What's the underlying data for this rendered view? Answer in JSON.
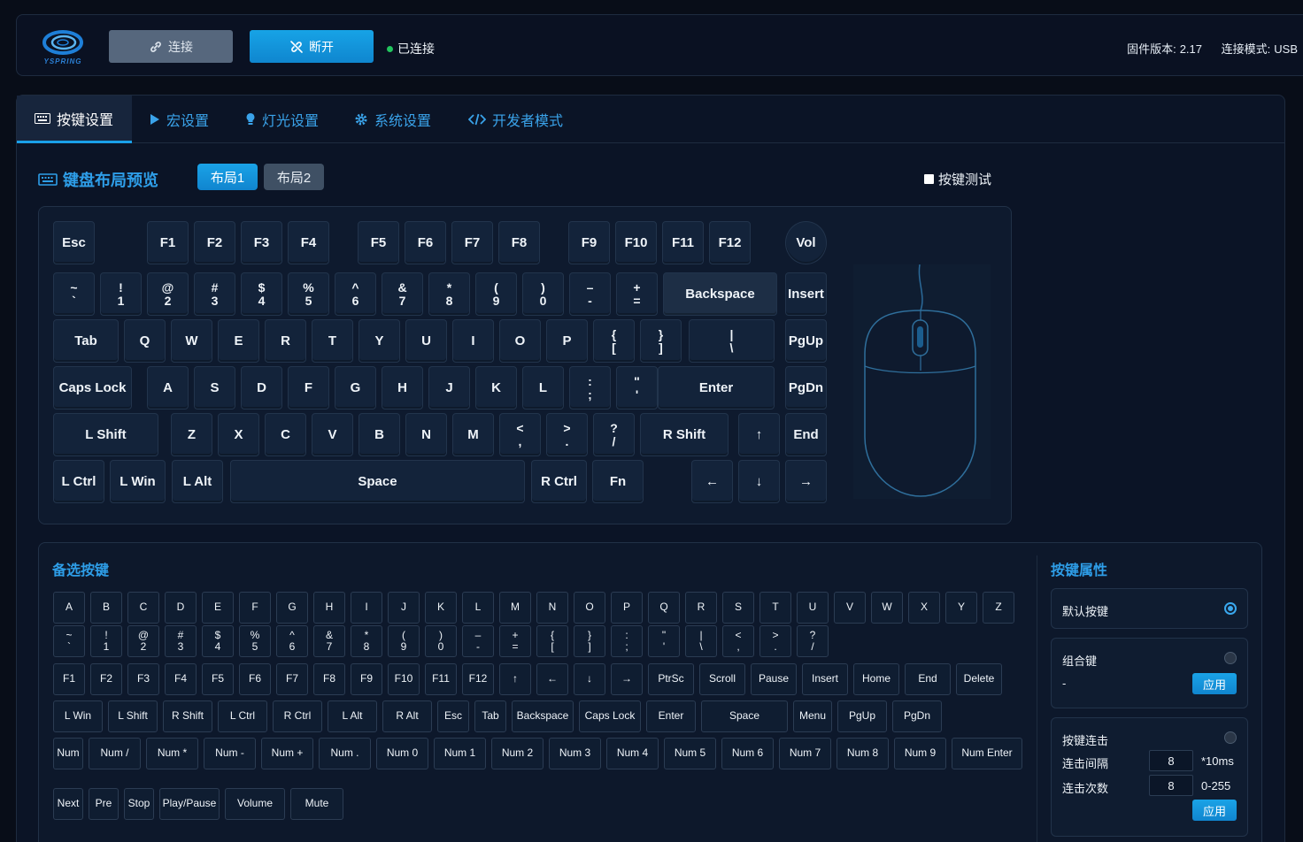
{
  "header": {
    "logo_text": "YSPRING",
    "connect_label": "连接",
    "disconnect_label": "断开",
    "status_text": "已连接",
    "firmware_label": "固件版本:",
    "firmware_value": "2.17",
    "mode_label": "连接模式:",
    "mode_value": "USB"
  },
  "tabs": [
    "按键设置",
    "宏设置",
    "灯光设置",
    "系统设置",
    "开发者模式"
  ],
  "layout_section": {
    "title": "键盘布局预览",
    "layout1": "布局1",
    "layout2": "布局2",
    "key_test": "按键测试"
  },
  "keyboard": {
    "rows": [
      [
        "Esc",
        "F1",
        "F2",
        "F3",
        "F4",
        "F5",
        "F6",
        "F7",
        "F8",
        "F9",
        "F10",
        "F11",
        "F12",
        "Vol"
      ],
      [
        "~\n`",
        "!\n1",
        "@\n2",
        "#\n3",
        "$\n4",
        "%\n5",
        "^\n6",
        "&\n7",
        "*\n8",
        "(\n9",
        ")\n0",
        "–\n-",
        "+\n=",
        "Backspace",
        "Insert"
      ],
      [
        "Tab",
        "Q",
        "W",
        "E",
        "R",
        "T",
        "Y",
        "U",
        "I",
        "O",
        "P",
        "{\n[",
        "}\n]",
        "|\n\\",
        "PgUp"
      ],
      [
        "Caps Lock",
        "A",
        "S",
        "D",
        "F",
        "G",
        "H",
        "J",
        "K",
        "L",
        ":\n;",
        "\"\n'",
        "Enter",
        "PgDn"
      ],
      [
        "L Shift",
        "Z",
        "X",
        "C",
        "V",
        "B",
        "N",
        "M",
        "<\n,",
        ">\n.",
        "?\n/",
        "R Shift",
        "↑",
        "End"
      ],
      [
        "L Ctrl",
        "L Win",
        "L Alt",
        "Space",
        "R Ctrl",
        "Fn",
        "←",
        "↓",
        "→"
      ]
    ]
  },
  "alt_section": {
    "title": "备选按键",
    "rows": [
      [
        "A",
        "B",
        "C",
        "D",
        "E",
        "F",
        "G",
        "H",
        "I",
        "J",
        "K",
        "L",
        "M",
        "N",
        "O",
        "P",
        "Q",
        "R",
        "S",
        "T",
        "U",
        "V",
        "W",
        "X",
        "Y",
        "Z"
      ],
      [
        "~\n`",
        "!\n1",
        "@\n2",
        "#\n3",
        "$\n4",
        "%\n5",
        "^\n6",
        "&\n7",
        "*\n8",
        "(\n9",
        ")\n0",
        "–\n-",
        "+\n=",
        "{\n[",
        "}\n]",
        ":\n;",
        "\"\n'",
        "|\n\\",
        "<\n,",
        ">\n.",
        "?\n/"
      ],
      [
        "F1",
        "F2",
        "F3",
        "F4",
        "F5",
        "F6",
        "F7",
        "F8",
        "F9",
        "F10",
        "F11",
        "F12",
        "↑",
        "←",
        "↓",
        "→",
        "PtrSc",
        "Scroll",
        "Pause",
        "Insert",
        "Home",
        "End",
        "Delete"
      ],
      [
        "L Win",
        "L Shift",
        "R Shift",
        "L Ctrl",
        "R Ctrl",
        "L Alt",
        "R Alt",
        "Esc",
        "Tab",
        "Backspace",
        "Caps Lock",
        "Enter",
        "Space",
        "Menu",
        "PgUp",
        "PgDn"
      ],
      [
        "Num",
        "Num /",
        "Num *",
        "Num -",
        "Num +",
        "Num .",
        "Num 0",
        "Num 1",
        "Num 2",
        "Num 3",
        "Num 4",
        "Num 5",
        "Num 6",
        "Num 7",
        "Num 8",
        "Num 9",
        "Num Enter"
      ],
      [
        "Next",
        "Pre",
        "Stop",
        "Play/Pause",
        "Volume",
        "Mute"
      ]
    ]
  },
  "properties": {
    "title": "按键属性",
    "default_key": "默认按键",
    "combo_key": "组合键",
    "combo_value": "-",
    "apply_label": "应用",
    "repeat_title": "按键连击",
    "interval_label": "连击间隔",
    "interval_value": "8",
    "interval_unit": "*10ms",
    "count_label": "连击次数",
    "count_value": "8",
    "count_range": "0-255"
  }
}
